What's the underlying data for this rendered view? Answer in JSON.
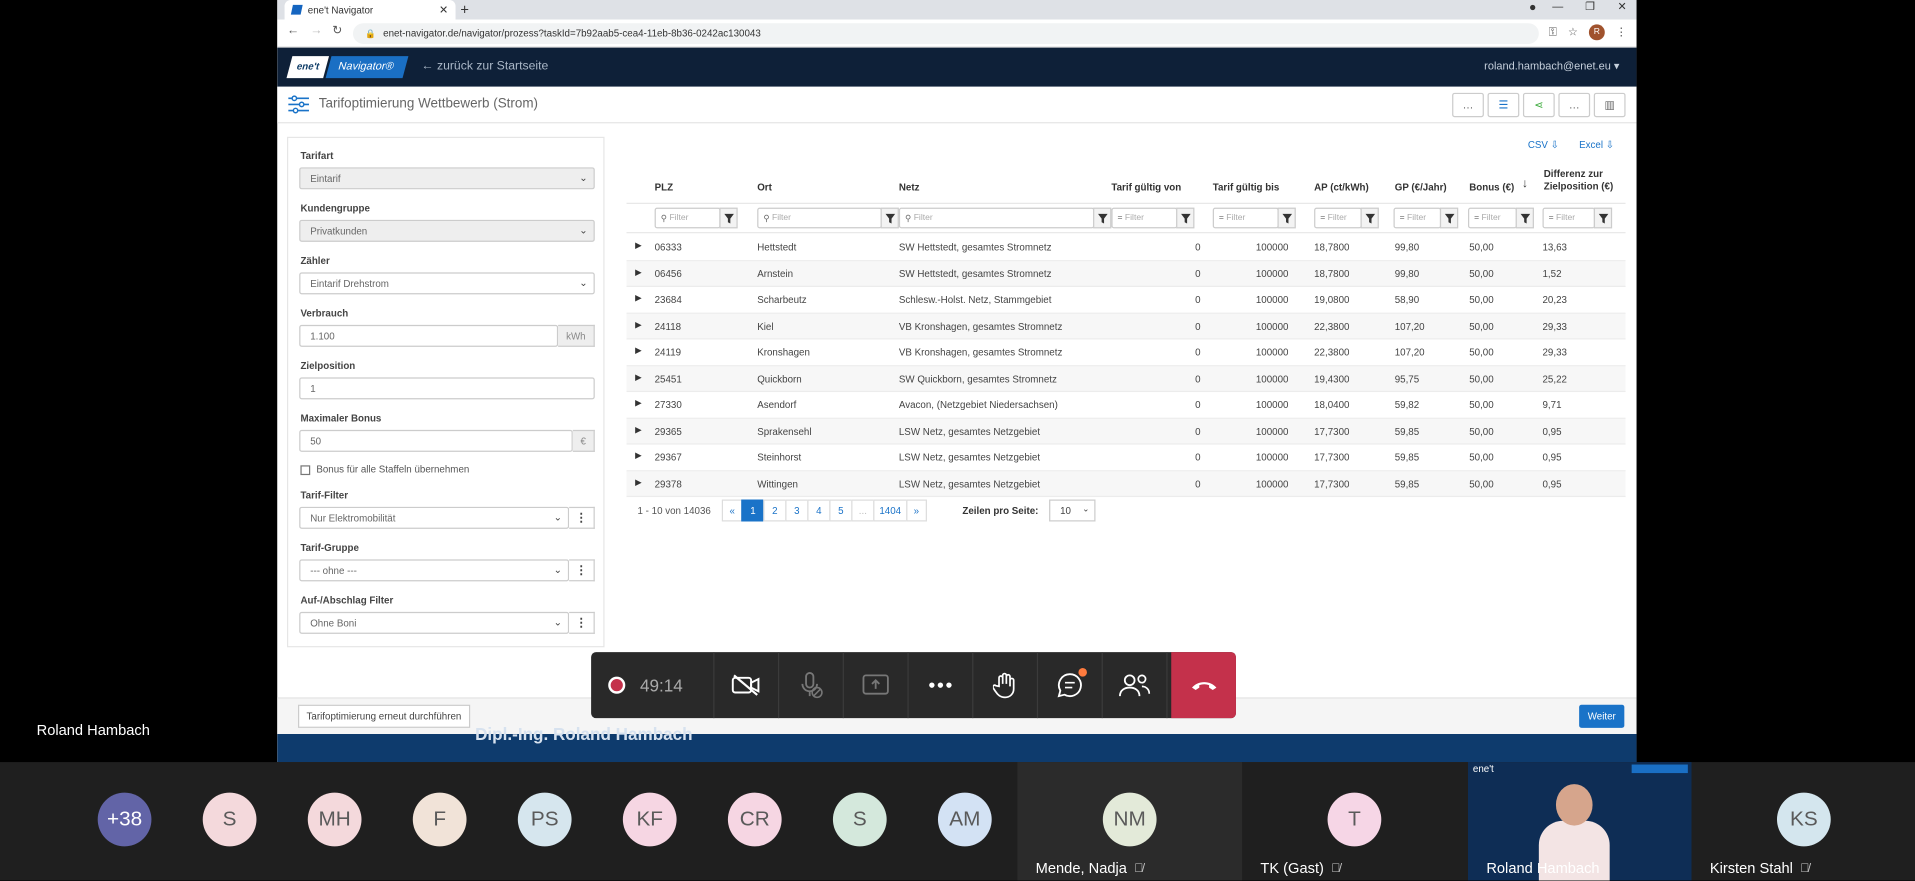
{
  "browser": {
    "tab_title": "ene't Navigator",
    "url": "enet-navigator.de/navigator/prozess?taskId=7b92aab5-cea4-11eb-8b36-0242ac130043",
    "profile_initial": "R"
  },
  "app": {
    "brand_short": "ene't",
    "brand_product": "Navigator®",
    "back_link": "zurück zur Startseite",
    "user": "roland.hambach@enet.eu",
    "page_title": "Tarifoptimierung Wettbewerb (Strom)"
  },
  "form": {
    "tarifart_label": "Tarifart",
    "tarifart_value": "Eintarif",
    "kundengruppe_label": "Kundengruppe",
    "kundengruppe_value": "Privatkunden",
    "zaehler_label": "Zähler",
    "zaehler_value": "Eintarif Drehstrom",
    "verbrauch_label": "Verbrauch",
    "verbrauch_value": "1.100",
    "verbrauch_unit": "kWh",
    "zielposition_label": "Zielposition",
    "zielposition_value": "1",
    "bonus_label": "Maximaler Bonus",
    "bonus_value": "50",
    "bonus_unit": "€",
    "staffeln_label": "Bonus für alle Staffeln übernehmen",
    "tariffilter_label": "Tarif-Filter",
    "tariffilter_value": "Nur Elektromobilität",
    "tarifgruppe_label": "Tarif-Gruppe",
    "tarifgruppe_value": "--- ohne ---",
    "abschlag_label": "Auf-/Abschlag Filter",
    "abschlag_value": "Ohne Boni"
  },
  "export": {
    "csv": "CSV",
    "excel": "Excel"
  },
  "table": {
    "columns": [
      "PLZ",
      "Ort",
      "Netz",
      "Tarif gültig von",
      "Tarif gültig bis",
      "AP (ct/kWh)",
      "GP (€/Jahr)",
      "Bonus (€)",
      "Differenz zur",
      "Zielposition (€)"
    ],
    "filter_placeholder": "Filter",
    "rows": [
      [
        "06333",
        "Hettstedt",
        "SW Hettstedt, gesamtes Stromnetz",
        "0",
        "100000",
        "18,7800",
        "99,80",
        "50,00",
        "13,63"
      ],
      [
        "06456",
        "Arnstein",
        "SW Hettstedt, gesamtes Stromnetz",
        "0",
        "100000",
        "18,7800",
        "99,80",
        "50,00",
        "1,52"
      ],
      [
        "23684",
        "Scharbeutz",
        "Schlesw.-Holst. Netz, Stammgebiet",
        "0",
        "100000",
        "19,0800",
        "58,90",
        "50,00",
        "20,23"
      ],
      [
        "24118",
        "Kiel",
        "VB Kronshagen, gesamtes Stromnetz",
        "0",
        "100000",
        "22,3800",
        "107,20",
        "50,00",
        "29,33"
      ],
      [
        "24119",
        "Kronshagen",
        "VB Kronshagen, gesamtes Stromnetz",
        "0",
        "100000",
        "22,3800",
        "107,20",
        "50,00",
        "29,33"
      ],
      [
        "25451",
        "Quickborn",
        "SW Quickborn, gesamtes Stromnetz",
        "0",
        "100000",
        "19,4300",
        "95,75",
        "50,00",
        "25,22"
      ],
      [
        "27330",
        "Asendorf",
        "Avacon, (Netzgebiet Niedersachsen)",
        "0",
        "100000",
        "18,0400",
        "59,82",
        "50,00",
        "9,71"
      ],
      [
        "29365",
        "Sprakensehl",
        "LSW Netz, gesamtes Netzgebiet",
        "0",
        "100000",
        "17,7300",
        "59,85",
        "50,00",
        "0,95"
      ],
      [
        "29367",
        "Steinhorst",
        "LSW Netz, gesamtes Netzgebiet",
        "0",
        "100000",
        "17,7300",
        "59,85",
        "50,00",
        "0,95"
      ],
      [
        "29378",
        "Wittingen",
        "LSW Netz, gesamtes Netzgebiet",
        "0",
        "100000",
        "17,7300",
        "59,85",
        "50,00",
        "0,95"
      ]
    ]
  },
  "pager": {
    "info": "1 - 10 von 14036",
    "pages": [
      "«",
      "1",
      "2",
      "3",
      "4",
      "5",
      "...",
      "1404",
      "»"
    ],
    "active": "1",
    "rows_label": "Zeilen pro Seite:",
    "rows_value": "10"
  },
  "footer": {
    "rerun": "Tarifoptimierung erneut durchführen",
    "next": "Weiter",
    "band_text": "Dipl.-Ing. Roland Hambach"
  },
  "teams": {
    "presenter": "Roland Hambach",
    "timer": "49:14",
    "participants": [
      {
        "initials": "+38",
        "color": "#6264a7",
        "text": "#ffffff"
      },
      {
        "initials": "S",
        "color": "#f4d9dc",
        "text": "#5a5a5a"
      },
      {
        "initials": "MH",
        "color": "#f4d9dc",
        "text": "#5a5a5a"
      },
      {
        "initials": "F",
        "color": "#f1e3d8",
        "text": "#5a5a5a"
      },
      {
        "initials": "PS",
        "color": "#d6e6ee",
        "text": "#5a5a5a"
      },
      {
        "initials": "KF",
        "color": "#f6d6e3",
        "text": "#5a5a5a"
      },
      {
        "initials": "CR",
        "color": "#f6d6e3",
        "text": "#5a5a5a"
      },
      {
        "initials": "S",
        "color": "#d4e8dc",
        "text": "#5a5a5a"
      },
      {
        "initials": "AM",
        "color": "#d3e2f4",
        "text": "#5a5a5a"
      }
    ],
    "tile_nm": {
      "initials": "NM",
      "name": "Mende, Nadja"
    },
    "tile_tk": {
      "initials": "T",
      "name": "TK (Gast)"
    },
    "tile_rh": {
      "name": "Roland Hambach",
      "logo": "ene't"
    },
    "tile_ks": {
      "initials": "KS",
      "name": "Kirsten Stahl"
    }
  }
}
